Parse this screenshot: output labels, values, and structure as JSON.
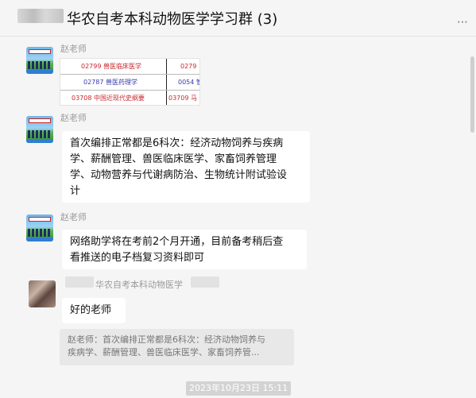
{
  "window": {
    "controls": [
      "⊥",
      "—",
      "☐",
      "✕"
    ]
  },
  "header": {
    "title": "华农自考本科动物医学学习群 (3)",
    "more_icon": "ellipsis-icon"
  },
  "messages": [
    {
      "sender": "赵老师",
      "type": "image",
      "table_rows": [
        {
          "left": "02799  兽医临床医学",
          "right": "0279"
        },
        {
          "left": "02787  兽医药理学",
          "right": "0054  管"
        },
        {
          "left": "03708  中国近现代史纲要",
          "right": "03709  马"
        }
      ]
    },
    {
      "sender": "赵老师",
      "type": "text",
      "lines": [
        "首次编排正常都是6科次：经济动物饲养与疾病",
        "学、薪酬管理、兽医临床医学、家畜饲养管理",
        "学、动物营养与代谢病防治、生物统计附试验设",
        "计"
      ]
    },
    {
      "sender": "赵老师",
      "type": "text",
      "lines": [
        "网络助学将在考前2个月开通，目前备考稍后查",
        "看推送的电子档复习资料即可"
      ]
    },
    {
      "sender_group": "华农自考本科动物医学",
      "type": "text",
      "lines": [
        "好的老师"
      ],
      "quote_lines": [
        "赵老师：首次编排正常都是6科次：经济动物饲养与",
        "疾病学、薪酬管理、兽医临床医学、家畜饲养管..."
      ]
    }
  ],
  "timestamp": "2023年10月23日 15:11"
}
